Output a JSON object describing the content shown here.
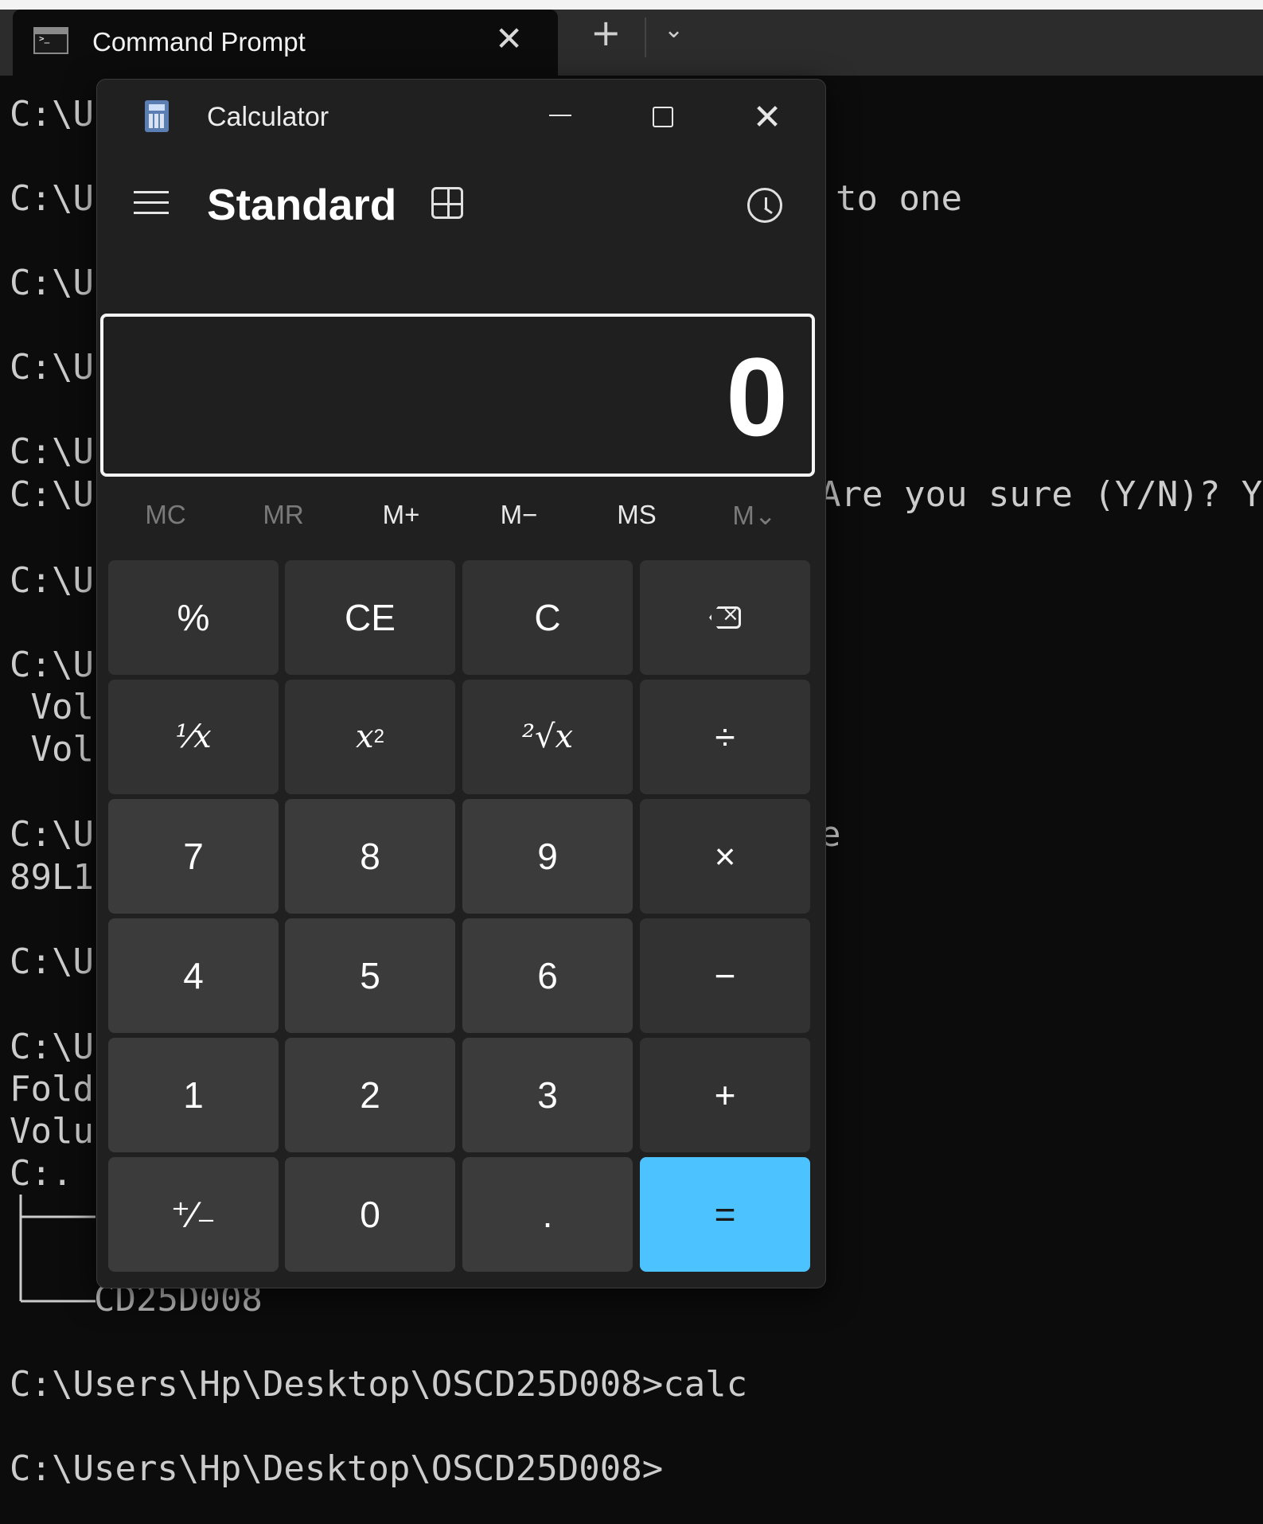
{
  "terminal": {
    "tab_title": "Command Prompt",
    "new_tab": "+",
    "dropdown": "⌄",
    "close": "✕",
    "left_fragments": [
      "C:\\U",
      "C:\\U",
      "C:\\U",
      "C:\\U",
      "C:\\U",
      "C:\\U",
      "C:\\U",
      "C:\\U",
      " Vol",
      " Vol",
      "C:\\U",
      "89L1",
      "C:\\U",
      "C:\\U",
      "Fold",
      "Volu",
      "C:."
    ],
    "right_fragments": {
      "line1": "to one",
      "line2": "Are you sure (Y/N)? Y",
      "line3": "e"
    },
    "tree_tail": "CD25D008",
    "prompt_calc": "C:\\Users\\Hp\\Desktop\\OSCD25D008>calc",
    "prompt_final": "C:\\Users\\Hp\\Desktop\\OSCD25D008>"
  },
  "calculator": {
    "window_title": "Calculator",
    "mode": "Standard",
    "display": "0",
    "memory": [
      {
        "label": "MC",
        "enabled": false
      },
      {
        "label": "MR",
        "enabled": false
      },
      {
        "label": "M+",
        "enabled": true
      },
      {
        "label": "M−",
        "enabled": true
      },
      {
        "label": "MS",
        "enabled": true
      },
      {
        "label": "M⌄",
        "enabled": false
      }
    ],
    "keys": {
      "percent": "%",
      "ce": "CE",
      "c": "C",
      "reciprocal": "⅟x",
      "square": "x",
      "square_exp": "2",
      "sqrt": "²√x",
      "divide": "÷",
      "seven": "7",
      "eight": "8",
      "nine": "9",
      "multiply": "×",
      "four": "4",
      "five": "5",
      "six": "6",
      "minus": "−",
      "one": "1",
      "two": "2",
      "three": "3",
      "plus": "+",
      "negate": "⁺∕₋",
      "zero": "0",
      "decimal": ".",
      "equals": "="
    },
    "colors": {
      "accent": "#4cc2ff",
      "background": "#202020"
    }
  }
}
